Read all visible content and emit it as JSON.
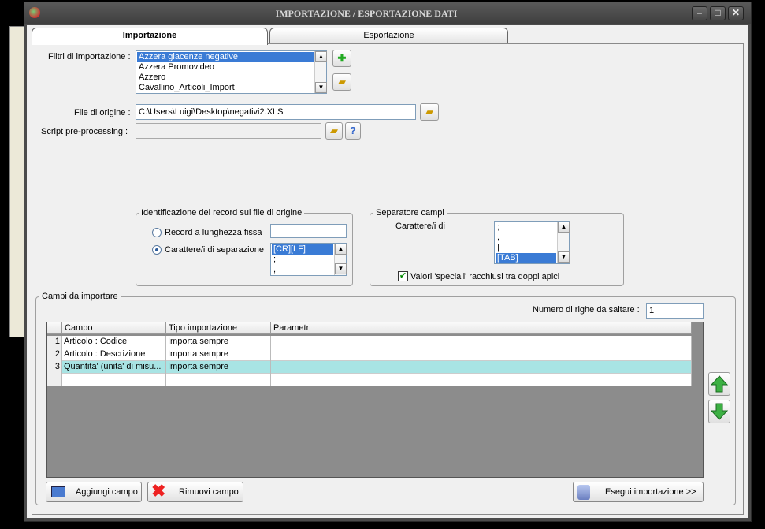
{
  "window": {
    "title": "IMPORTAZIONE / ESPORTAZIONE DATI"
  },
  "tabs": [
    {
      "label": "Importazione"
    },
    {
      "label": "Esportazione"
    }
  ],
  "filters": {
    "label": "Filtri di importazione :",
    "items": [
      "Azzera giacenze negative",
      "Azzera Promovideo",
      "Azzero",
      "Cavallino_Articoli_Import"
    ]
  },
  "source": {
    "label": "File di origine :",
    "value": "C:\\Users\\Luigi\\Desktop\\negativi2.XLS"
  },
  "script": {
    "label": "Script pre-processing :",
    "value": ""
  },
  "record_id": {
    "title": "Identificazione dei record sul file di origine",
    "fixed_label": "Record a lunghezza fissa",
    "sep_label": "Carattere/i di separazione",
    "sep_items": [
      "[CR][LF]",
      ";",
      ","
    ]
  },
  "field_sep": {
    "title": "Separatore campi",
    "char_label": "Carattere/i di",
    "items": [
      ";",
      ",",
      "|",
      "[TAB]"
    ],
    "special_label": "Valori 'speciali' racchiusi tra doppi apici"
  },
  "fields": {
    "title": "Campi da importare",
    "skip_label": "Numero di righe da saltare :",
    "skip_value": "1",
    "columns": [
      "Campo",
      "Tipo importazione",
      "Parametri"
    ],
    "rows": [
      {
        "n": "1",
        "campo": "Articolo : Codice",
        "tipo": "Importa sempre",
        "param": ""
      },
      {
        "n": "2",
        "campo": "Articolo : Descrizione",
        "tipo": "Importa sempre",
        "param": ""
      },
      {
        "n": "3",
        "campo": "Quantita' (unita' di misu...",
        "tipo": "Importa sempre",
        "param": ""
      }
    ]
  },
  "buttons": {
    "add": "Aggiungi campo",
    "remove": "Rimuovi campo",
    "run": "Esegui importazione >>"
  }
}
